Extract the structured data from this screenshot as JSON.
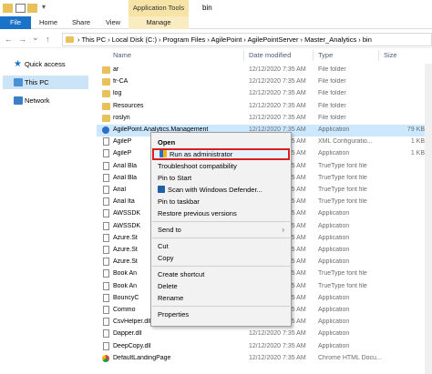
{
  "window": {
    "app_tools_label": "Application Tools",
    "title": "bin"
  },
  "ribbon": {
    "tabs": [
      {
        "label": "File"
      },
      {
        "label": "Home"
      },
      {
        "label": "Share"
      },
      {
        "label": "View"
      },
      {
        "label": "Manage"
      }
    ]
  },
  "address": {
    "nav_back": "←",
    "nav_forward": "→",
    "nav_recent": "⌄",
    "nav_up": "↑",
    "path": "›  This PC  ›  Local Disk (C:)  ›  Program Files  ›  AgilePoint  ›  AgilePointServer  ›  Master_Analytics  ›  bin"
  },
  "sidebar": {
    "items": [
      {
        "label": "Quick access",
        "icon": "star-icon"
      },
      {
        "label": "This PC",
        "icon": "computer-icon"
      },
      {
        "label": "Network",
        "icon": "network-icon"
      }
    ]
  },
  "columns": {
    "name": "Name",
    "date": "Date modified",
    "type": "Type",
    "size": "Size"
  },
  "files": [
    {
      "name": "ar",
      "date": "12/12/2020 7:35 AM",
      "type": "File folder",
      "size": "",
      "icon": "folder"
    },
    {
      "name": "fr-CA",
      "date": "12/12/2020 7:35 AM",
      "type": "File folder",
      "size": "",
      "icon": "folder"
    },
    {
      "name": "log",
      "date": "12/12/2020 7:35 AM",
      "type": "File folder",
      "size": "",
      "icon": "folder"
    },
    {
      "name": "Resources",
      "date": "12/12/2020 7:35 AM",
      "type": "File folder",
      "size": "",
      "icon": "folder"
    },
    {
      "name": "roslyn",
      "date": "12/12/2020 7:35 AM",
      "type": "File folder",
      "size": "",
      "icon": "folder"
    },
    {
      "name": "AgilePoint.Analytics.Management",
      "date": "12/12/2020 7:35 AM",
      "type": "Application",
      "size": "79 KB",
      "icon": "app"
    },
    {
      "name": "AgileP",
      "date": "12/12/2020 7:35 AM",
      "type": "XML Configuratio...",
      "size": "1 KB",
      "icon": "doc"
    },
    {
      "name": "AgileP",
      "date": "12/12/2020 7:35 AM",
      "type": "Application",
      "size": "1 KB",
      "icon": "doc"
    },
    {
      "name": "Arial Bla",
      "date": "12/12/2020 7:35 AM",
      "type": "TrueType font file",
      "size": "",
      "icon": "font"
    },
    {
      "name": "Arial Bla",
      "date": "12/12/2020 7:35 AM",
      "type": "TrueType font file",
      "size": "",
      "icon": "font"
    },
    {
      "name": "Arial",
      "date": "12/12/2020 7:35 AM",
      "type": "TrueType font file",
      "size": "",
      "icon": "font"
    },
    {
      "name": "Arial Ita",
      "date": "12/12/2020 7:35 AM",
      "type": "TrueType font file",
      "size": "",
      "icon": "font"
    },
    {
      "name": "AWSSDK",
      "date": "12/12/2020 7:35 AM",
      "type": "Application",
      "size": "",
      "icon": "doc"
    },
    {
      "name": "AWSSDK",
      "date": "12/12/2020 7:35 AM",
      "type": "Application",
      "size": "",
      "icon": "doc"
    },
    {
      "name": "Azure.St",
      "date": "12/12/2020 7:35 AM",
      "type": "Application",
      "size": "",
      "icon": "doc"
    },
    {
      "name": "Azure.St",
      "date": "12/12/2020 7:35 AM",
      "type": "Application",
      "size": "",
      "icon": "doc"
    },
    {
      "name": "Azure.St",
      "date": "12/12/2020 7:35 AM",
      "type": "Application",
      "size": "",
      "icon": "doc"
    },
    {
      "name": "Book An",
      "date": "12/12/2020 7:35 AM",
      "type": "TrueType font file",
      "size": "",
      "icon": "font"
    },
    {
      "name": "Book An",
      "date": "12/12/2020 7:35 AM",
      "type": "TrueType font file",
      "size": "",
      "icon": "font"
    },
    {
      "name": "BouncyC",
      "date": "12/12/2020 7:35 AM",
      "type": "Application",
      "size": "",
      "icon": "doc"
    },
    {
      "name": "Commo",
      "date": "12/12/2020 7:35 AM",
      "type": "Application",
      "size": "",
      "icon": "doc"
    },
    {
      "name": "CsvHelper.dll",
      "date": "12/12/2020 7:35 AM",
      "type": "Application",
      "size": "",
      "icon": "doc"
    },
    {
      "name": "Dapper.dll",
      "date": "12/12/2020 7:35 AM",
      "type": "Application",
      "size": "",
      "icon": "doc"
    },
    {
      "name": "DeepCopy.dll",
      "date": "12/12/2020 7:35 AM",
      "type": "Application",
      "size": "",
      "icon": "doc"
    },
    {
      "name": "DefaultLandingPage",
      "date": "12/12/2020 7:35 AM",
      "type": "Chrome HTML Docu...",
      "size": "",
      "icon": "chrome"
    }
  ],
  "context_menu": {
    "items": [
      {
        "label": "Open",
        "bold": true
      },
      {
        "label": "Run as administrator",
        "highlighted": true,
        "icon": "shield-icon"
      },
      {
        "label": "Troubleshoot compatibility"
      },
      {
        "label": "Pin to Start"
      },
      {
        "label": "Scan with Windows Defender...",
        "icon": "defender-icon"
      },
      {
        "label": "Pin to taskbar"
      },
      {
        "label": "Restore previous versions"
      },
      {
        "sep": true
      },
      {
        "label": "Send to",
        "submenu": true
      },
      {
        "sep": true
      },
      {
        "label": "Cut"
      },
      {
        "label": "Copy"
      },
      {
        "sep": true
      },
      {
        "label": "Create shortcut"
      },
      {
        "label": "Delete"
      },
      {
        "label": "Rename"
      },
      {
        "sep": true
      },
      {
        "label": "Properties"
      }
    ],
    "submenu_arrow": "›"
  },
  "colors": {
    "file_tab": "#1a73c8",
    "app_tools": "#f5e4a6",
    "selection": "#cce8ff",
    "highlight_border": "#d81e1e"
  }
}
